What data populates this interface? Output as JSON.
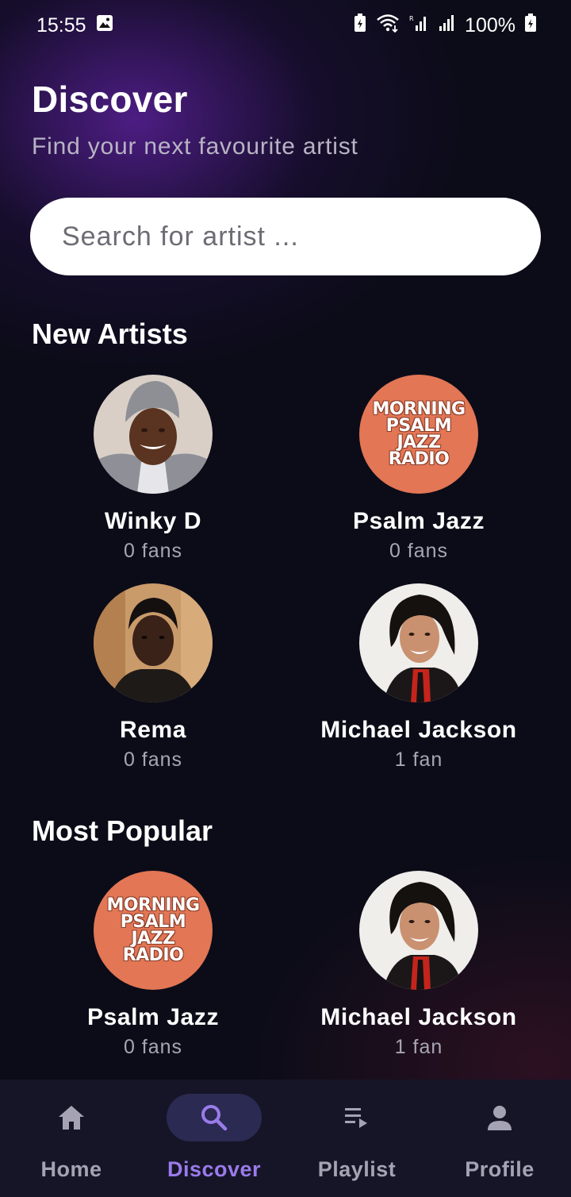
{
  "status_bar": {
    "time": "15:55",
    "battery": "100%",
    "icons": [
      "gallery-icon",
      "data-saver-icon",
      "wifi-icon",
      "signal-icon",
      "signal-icon",
      "battery-charging-icon"
    ]
  },
  "header": {
    "title": "Discover",
    "subtitle": "Find your next favourite artist"
  },
  "search": {
    "placeholder": "Search for artist ..."
  },
  "new_artists": {
    "title": "New Artists",
    "items": [
      {
        "name": "Winky D",
        "fans": "0 fans"
      },
      {
        "name": "Psalm Jazz",
        "fans": "0 fans",
        "logo": [
          "MORNING",
          "PSALM",
          "JAZZ",
          "RADIO"
        ]
      },
      {
        "name": "Rema",
        "fans": "0 fans"
      },
      {
        "name": "Michael Jackson",
        "fans": "1 fan"
      }
    ]
  },
  "most_popular": {
    "title": "Most Popular",
    "items": [
      {
        "name": "Psalm Jazz",
        "fans": "0 fans",
        "logo": [
          "MORNING",
          "PSALM",
          "JAZZ",
          "RADIO"
        ]
      },
      {
        "name": "Michael Jackson",
        "fans": "1 fan"
      }
    ]
  },
  "bottom_nav": {
    "active": "Discover",
    "items": [
      {
        "label": "Home",
        "icon": "home-icon"
      },
      {
        "label": "Discover",
        "icon": "search-icon"
      },
      {
        "label": "Playlist",
        "icon": "playlist-icon"
      },
      {
        "label": "Profile",
        "icon": "person-icon"
      }
    ]
  },
  "colors": {
    "background": "#0c0c18",
    "accent": "#9a7bea",
    "nav_background": "#161528",
    "logo_orange": "#e27655"
  }
}
